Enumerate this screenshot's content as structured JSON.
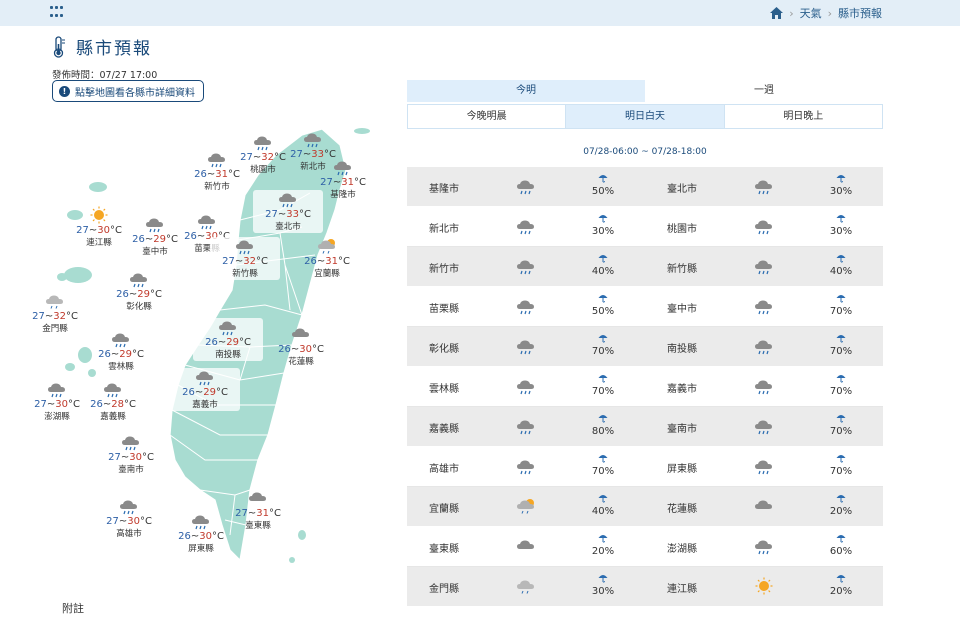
{
  "header": {
    "breadcrumb": [
      "天氣",
      "縣市預報"
    ]
  },
  "page": {
    "title": "縣市預報",
    "issue_time": "發佈時間：07/27 17:00",
    "hint_button": "點擊地圖看各縣市詳細資料",
    "footnote": "附註"
  },
  "tabs": {
    "top": [
      {
        "label": "今明",
        "active": true
      },
      {
        "label": "一週",
        "active": false
      }
    ],
    "sub": [
      {
        "label": "今晚明晨",
        "active": false
      },
      {
        "label": "明日白天",
        "active": true
      },
      {
        "label": "明日晚上",
        "active": false
      }
    ]
  },
  "time_range": "07/28-06:00 ~ 07/28-18:00",
  "map": {
    "labels": [
      {
        "name": "新竹市",
        "lo": "26",
        "hi": "31",
        "icon": "cloud-rain-icon"
      },
      {
        "name": "桃園市",
        "lo": "27",
        "hi": "32",
        "icon": "cloud-rain-icon"
      },
      {
        "name": "新北市",
        "lo": "27",
        "hi": "33",
        "icon": "cloud-rain-icon"
      },
      {
        "name": "基隆市",
        "lo": "27",
        "hi": "31",
        "icon": "cloud-rain-icon"
      },
      {
        "name": "臺北市",
        "lo": "27",
        "hi": "33",
        "icon": "cloud-rain-icon"
      },
      {
        "name": "連江縣",
        "lo": "27",
        "hi": "30",
        "icon": "sun-icon"
      },
      {
        "name": "臺中市",
        "lo": "26",
        "hi": "29",
        "icon": "cloud-rain-icon"
      },
      {
        "name": "苗栗縣",
        "lo": "26",
        "hi": "30",
        "icon": "cloud-rain-icon"
      },
      {
        "name": "新竹縣",
        "lo": "27",
        "hi": "32",
        "icon": "cloud-rain-icon"
      },
      {
        "name": "宜蘭縣",
        "lo": "26",
        "hi": "31",
        "icon": "sun-cloud-rain-icon"
      },
      {
        "name": "彰化縣",
        "lo": "26",
        "hi": "29",
        "icon": "cloud-rain-icon"
      },
      {
        "name": "金門縣",
        "lo": "27",
        "hi": "32",
        "icon": "cloud-rain-light-icon"
      },
      {
        "name": "南投縣",
        "lo": "26",
        "hi": "29",
        "icon": "cloud-rain-icon"
      },
      {
        "name": "花蓮縣",
        "lo": "26",
        "hi": "30",
        "icon": "cloud-icon"
      },
      {
        "name": "雲林縣",
        "lo": "26",
        "hi": "29",
        "icon": "cloud-rain-icon"
      },
      {
        "name": "澎湖縣",
        "lo": "27",
        "hi": "30",
        "icon": "cloud-rain-icon"
      },
      {
        "name": "嘉義縣",
        "lo": "26",
        "hi": "28",
        "icon": "cloud-rain-icon"
      },
      {
        "name": "嘉義市",
        "lo": "26",
        "hi": "29",
        "icon": "cloud-rain-icon"
      },
      {
        "name": "臺南市",
        "lo": "27",
        "hi": "30",
        "icon": "cloud-rain-icon"
      },
      {
        "name": "高雄市",
        "lo": "27",
        "hi": "30",
        "icon": "cloud-rain-icon"
      },
      {
        "name": "屏東縣",
        "lo": "26",
        "hi": "30",
        "icon": "cloud-rain-icon"
      },
      {
        "name": "臺東縣",
        "lo": "27",
        "hi": "31",
        "icon": "cloud-icon"
      }
    ]
  },
  "table": {
    "rows": [
      [
        {
          "name": "基隆市",
          "pop": "50%",
          "icon": "cloud-rain-icon"
        },
        {
          "name": "臺北市",
          "pop": "30%",
          "icon": "cloud-rain-icon"
        }
      ],
      [
        {
          "name": "新北市",
          "pop": "30%",
          "icon": "cloud-rain-icon"
        },
        {
          "name": "桃園市",
          "pop": "30%",
          "icon": "cloud-rain-icon"
        }
      ],
      [
        {
          "name": "新竹市",
          "pop": "40%",
          "icon": "cloud-rain-icon"
        },
        {
          "name": "新竹縣",
          "pop": "40%",
          "icon": "cloud-rain-icon"
        }
      ],
      [
        {
          "name": "苗栗縣",
          "pop": "50%",
          "icon": "cloud-rain-icon"
        },
        {
          "name": "臺中市",
          "pop": "70%",
          "icon": "cloud-rain-icon"
        }
      ],
      [
        {
          "name": "彰化縣",
          "pop": "70%",
          "icon": "cloud-rain-icon"
        },
        {
          "name": "南投縣",
          "pop": "70%",
          "icon": "cloud-rain-icon"
        }
      ],
      [
        {
          "name": "雲林縣",
          "pop": "70%",
          "icon": "cloud-rain-icon"
        },
        {
          "name": "嘉義市",
          "pop": "70%",
          "icon": "cloud-rain-icon"
        }
      ],
      [
        {
          "name": "嘉義縣",
          "pop": "80%",
          "icon": "cloud-rain-icon"
        },
        {
          "name": "臺南市",
          "pop": "70%",
          "icon": "cloud-rain-icon"
        }
      ],
      [
        {
          "name": "高雄市",
          "pop": "70%",
          "icon": "cloud-rain-icon"
        },
        {
          "name": "屏東縣",
          "pop": "70%",
          "icon": "cloud-rain-icon"
        }
      ],
      [
        {
          "name": "宜蘭縣",
          "pop": "40%",
          "icon": "sun-cloud-rain-icon"
        },
        {
          "name": "花蓮縣",
          "pop": "20%",
          "icon": "cloud-icon"
        }
      ],
      [
        {
          "name": "臺東縣",
          "pop": "20%",
          "icon": "cloud-icon"
        },
        {
          "name": "澎湖縣",
          "pop": "60%",
          "icon": "cloud-rain-icon"
        }
      ],
      [
        {
          "name": "金門縣",
          "pop": "30%",
          "icon": "cloud-rain-light-icon"
        },
        {
          "name": "連江縣",
          "pop": "20%",
          "icon": "sun-icon"
        }
      ]
    ]
  },
  "colors": {
    "map_fill": "#a8dcd1",
    "accent": "#1a4a7a",
    "temp_low": "#2d5fa6",
    "temp_high": "#c0392b",
    "umbrella": "#2b6cb0"
  }
}
